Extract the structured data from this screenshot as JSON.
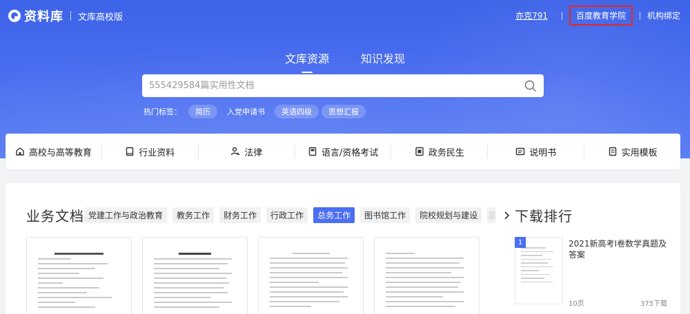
{
  "brand": {
    "name": "资料库",
    "subtitle": "文库高校版"
  },
  "top_right": {
    "user": "亦克791",
    "edu_link": "百度教育学院",
    "org_bind": "机构绑定"
  },
  "main_tabs": [
    {
      "label": "文库资源",
      "active": true
    },
    {
      "label": "知识发现",
      "active": false
    }
  ],
  "search": {
    "placeholder": "555429584篇实用性文档"
  },
  "hot_tags": {
    "label": "热门标签：",
    "tags": [
      "简历",
      "入党申请书",
      "英语四级",
      "思想汇报"
    ]
  },
  "categories": [
    {
      "label": "高校与高等教育",
      "icon": "school-icon"
    },
    {
      "label": "行业资料",
      "icon": "book-icon"
    },
    {
      "label": "法律",
      "icon": "law-icon"
    },
    {
      "label": "语言/资格考试",
      "icon": "exam-icon"
    },
    {
      "label": "政务民生",
      "icon": "government-icon"
    },
    {
      "label": "说明书",
      "icon": "manual-icon"
    },
    {
      "label": "实用模板",
      "icon": "template-icon"
    }
  ],
  "business_docs": {
    "title": "业务文档",
    "chips": [
      "党建工作与政治教育",
      "教务工作",
      "财务工作",
      "行政工作",
      "总务工作",
      "图书馆工作",
      "院校规划与建设"
    ],
    "active_chip": "总务工作"
  },
  "ranking": {
    "title": "下载排行",
    "items": [
      {
        "rank": "1",
        "name": "2021新高考Ⅰ卷数学真题及答案",
        "pages": "10页",
        "downloads": "375下载"
      }
    ]
  },
  "colors": {
    "brand_blue": "#3d63e8",
    "accent": "#4b6ef2",
    "highlight_border": "#e8281f"
  }
}
